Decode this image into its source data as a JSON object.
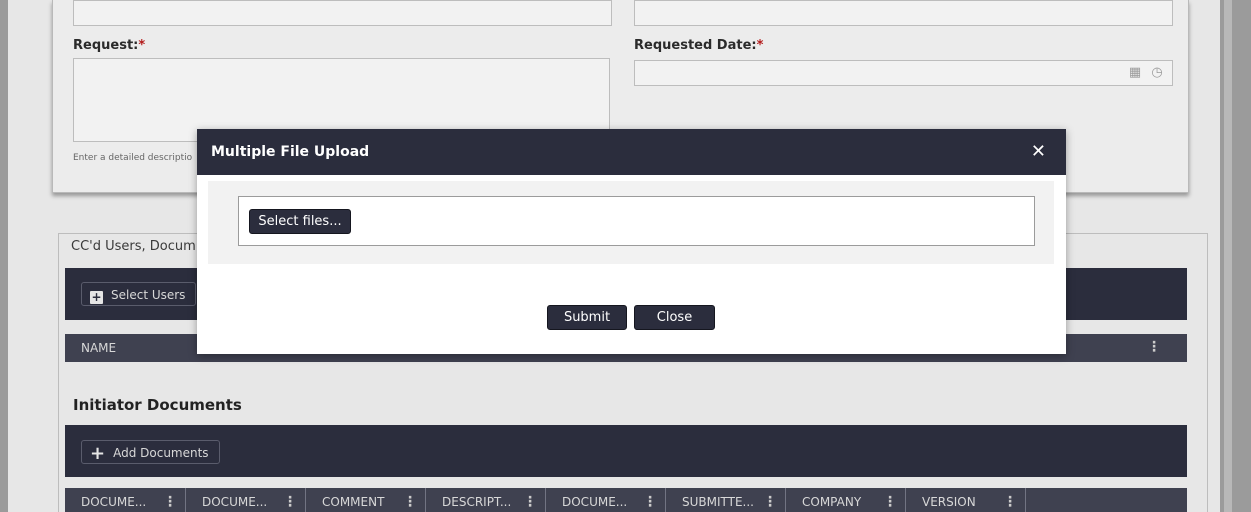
{
  "form": {
    "request_label": "Request:",
    "requested_date_label": "Requested Date:",
    "required_mark": "*",
    "request_hint": "Enter a detailed descriptio",
    "calendar_icon": "calendar-icon",
    "clock_icon": "clock-icon"
  },
  "cc_section": {
    "legend": "CC'd Users, Docum",
    "select_users_label": "Select Users",
    "name_column": "NAME"
  },
  "initiator": {
    "title": "Initiator Documents",
    "add_documents_label": "Add Documents",
    "columns": [
      "DOCUME...",
      "DOCUME...",
      "COMMENT",
      "DESCRIPT...",
      "DOCUME...",
      "SUBMITTE...",
      "COMPANY",
      "VERSION"
    ]
  },
  "modal": {
    "title": "Multiple File Upload",
    "close_glyph": "✕",
    "select_files_label": "Select files...",
    "submit_label": "Submit",
    "close_label": "Close"
  },
  "colors": {
    "header_dark": "#2b2d3d",
    "required": "#b31b1b",
    "overlay": "#9b9b9b"
  }
}
